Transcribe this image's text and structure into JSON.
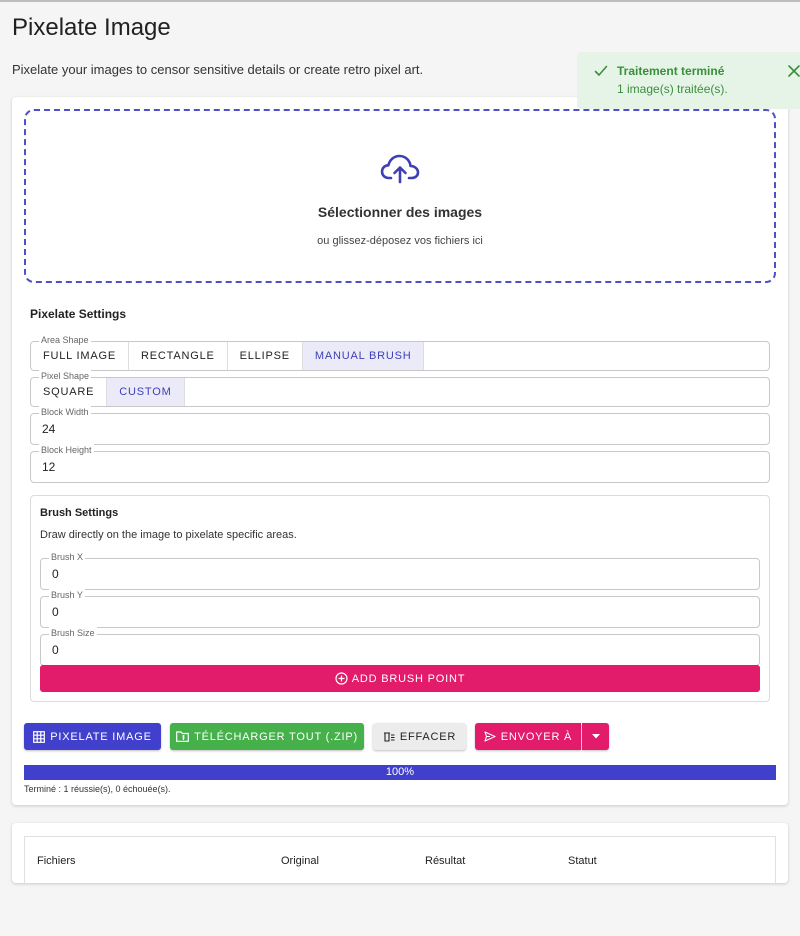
{
  "page": {
    "title": "Pixelate Image",
    "subtitle": "Pixelate your images to censor sensitive details or create retro pixel art."
  },
  "toast": {
    "title": "Traitement terminé",
    "message": "1 image(s) traitée(s).",
    "icon": "check-icon",
    "close_icon": "close-icon",
    "color": "#3a8f3d",
    "background": "#e6f4e7"
  },
  "dropzone": {
    "icon": "cloud-upload-icon",
    "title": "Sélectionner des images",
    "subtitle": "ou glissez-déposez vos fichiers ici"
  },
  "settings": {
    "title": "Pixelate Settings",
    "area_shape": {
      "label": "Area Shape",
      "options": [
        "FULL IMAGE",
        "RECTANGLE",
        "ELLIPSE",
        "MANUAL BRUSH"
      ],
      "selected": "MANUAL BRUSH"
    },
    "pixel_shape": {
      "label": "Pixel Shape",
      "options": [
        "SQUARE",
        "CUSTOM"
      ],
      "selected": "CUSTOM"
    },
    "block_width": {
      "label": "Block Width",
      "value": "24"
    },
    "block_height": {
      "label": "Block Height",
      "value": "12"
    }
  },
  "brush": {
    "title": "Brush Settings",
    "description": "Draw directly on the image to pixelate specific areas.",
    "x": {
      "label": "Brush X",
      "value": "0"
    },
    "y": {
      "label": "Brush Y",
      "value": "0"
    },
    "size": {
      "label": "Brush Size",
      "value": "0"
    },
    "add_button": "ADD BRUSH POINT"
  },
  "actions": {
    "pixelate": "PIXELATE IMAGE",
    "download": "TÉLÉCHARGER TOUT (.ZIP)",
    "clear": "EFFACER",
    "send": "ENVOYER À"
  },
  "progress": {
    "percent": 100,
    "label": "100%",
    "status": "Terminé : 1 réussie(s), 0 échouée(s)."
  },
  "table": {
    "columns": [
      "Fichiers",
      "Original",
      "Résultat",
      "Statut"
    ]
  },
  "colors": {
    "primary": "#4040cc",
    "success": "#46b14b",
    "accent": "#e21b6a"
  }
}
